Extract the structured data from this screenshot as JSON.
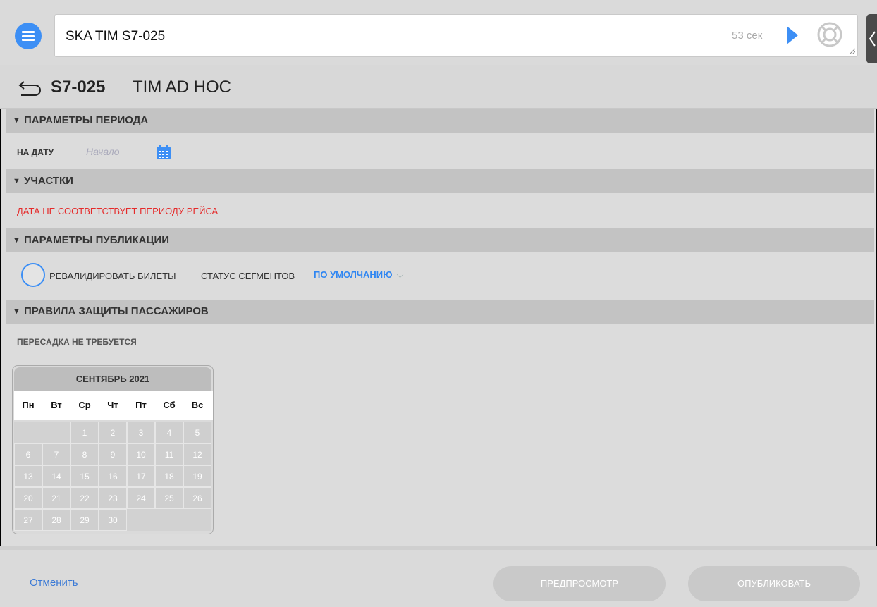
{
  "command_bar": {
    "text": "SKA TIM S7-025",
    "timer": "53 сек"
  },
  "title": {
    "code": "S7-025",
    "name": "TIM AD HOC"
  },
  "sections": {
    "period": "ПАРАМЕТРЫ ПЕРИОДА",
    "segments": "УЧАСТКИ",
    "publication": "ПАРАМЕТРЫ ПУБЛИКАЦИИ",
    "protection": "ПРАВИЛА ЗАЩИТЫ ПАССАЖИРОВ"
  },
  "period": {
    "date_label": "НА ДАТУ",
    "date_placeholder": "Начало"
  },
  "segments": {
    "error": "ДАТА НЕ СООТВЕТСТВУЕТ ПЕРИОДУ РЕЙСА"
  },
  "publication": {
    "revalidate_label": "РЕВАЛИДИРОВАТЬ БИЛЕТЫ",
    "status_label": "СТАТУС СЕГМЕНТОВ",
    "status_value": "ПО УМОЛЧАНИЮ"
  },
  "protection": {
    "transfer_text": "ПЕРЕСАДКА НЕ ТРЕБУЕТСЯ"
  },
  "calendar": {
    "month": "СЕНТЯБРЬ 2021",
    "weekdays": [
      "Пн",
      "Вт",
      "Ср",
      "Чт",
      "Пт",
      "Сб",
      "Вс"
    ],
    "cells": [
      "",
      "",
      "1",
      "2",
      "3",
      "4",
      "5",
      "6",
      "7",
      "8",
      "9",
      "10",
      "11",
      "12",
      "13",
      "14",
      "15",
      "16",
      "17",
      "18",
      "19",
      "20",
      "21",
      "22",
      "23",
      "24",
      "25",
      "26",
      "27",
      "28",
      "29",
      "30",
      "",
      "",
      ""
    ]
  },
  "footer": {
    "cancel": "Отменить",
    "preview": "ПРЕДПРОСМОТР",
    "publish": "ОПУБЛИКОВАТЬ"
  },
  "colors": {
    "accent": "#3d8ff5",
    "error": "#e52b2b",
    "section_bg": "#c3c3c3"
  }
}
